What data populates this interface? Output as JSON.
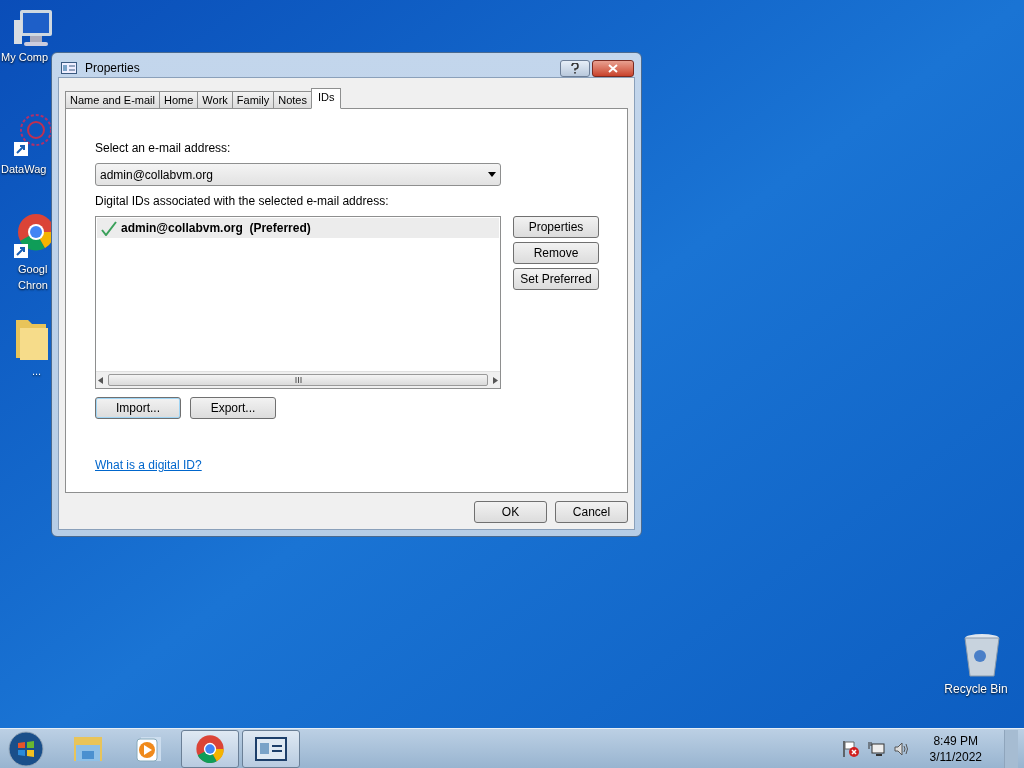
{
  "desktop_icons": [
    {
      "kind": "computer",
      "lines": [
        "My Comp"
      ]
    },
    {
      "kind": "network",
      "lines": [
        "DataWag"
      ]
    },
    {
      "kind": "chrome",
      "lines": [
        "Googl",
        "Chron"
      ]
    },
    {
      "kind": "folder",
      "lines": [
        "..."
      ]
    },
    {
      "kind": "recycle",
      "lines": [
        "Recycle Bin"
      ]
    }
  ],
  "dialog": {
    "title": "Properties",
    "tabs": [
      {
        "label": "Name and E-mail",
        "selected": false
      },
      {
        "label": "Home",
        "selected": false
      },
      {
        "label": "Work",
        "selected": false
      },
      {
        "label": "Family",
        "selected": false
      },
      {
        "label": "Notes",
        "selected": false
      },
      {
        "label": "IDs",
        "selected": true
      }
    ],
    "email_label": "Select an e-mail address:",
    "email_value": "admin@collabvm.org",
    "ids_label": "Digital IDs associated with the selected e-mail address:",
    "ids": [
      {
        "address": "admin@collabvm.org",
        "note": "(Preferred)",
        "preferred": true,
        "selected": true
      }
    ],
    "side_buttons": [
      "Properties",
      "Remove",
      "Set Preferred"
    ],
    "list_buttons": [
      {
        "label": "Import...",
        "focused": true
      },
      {
        "label": "Export...",
        "focused": false
      }
    ],
    "link": "What is a digital ID?",
    "footer_buttons": [
      "OK",
      "Cancel"
    ]
  },
  "taskbar": {
    "items": [
      {
        "kind": "explorer",
        "selected": false
      },
      {
        "kind": "media",
        "selected": false
      },
      {
        "kind": "chrome",
        "selected": true
      },
      {
        "kind": "contacts",
        "selected": true
      }
    ],
    "time": "8:49 PM",
    "date": "3/11/2022"
  }
}
